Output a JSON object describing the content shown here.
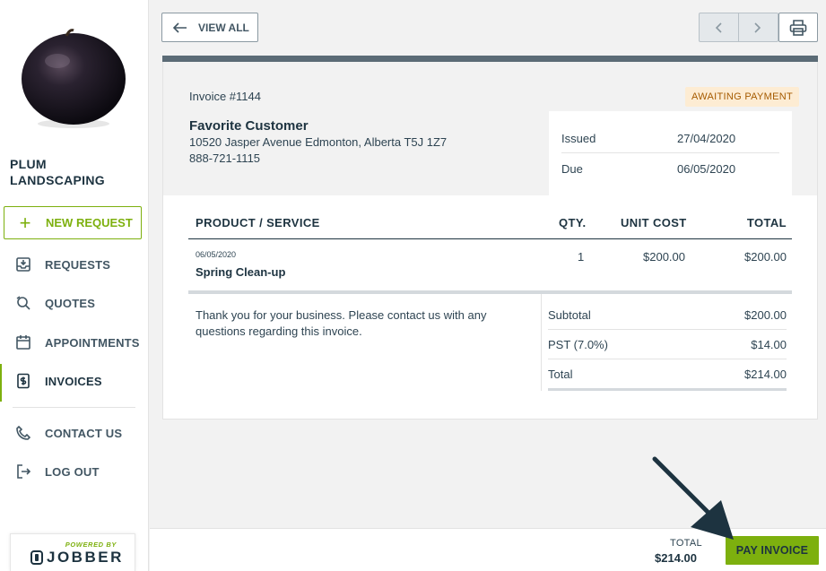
{
  "sidebar": {
    "company_name": "PLUM LANDSCAPING",
    "new_request_label": "NEW REQUEST",
    "items": [
      {
        "label": "REQUESTS",
        "icon": "inbox-icon"
      },
      {
        "label": "QUOTES",
        "icon": "quote-search-icon"
      },
      {
        "label": "APPOINTMENTS",
        "icon": "calendar-icon"
      },
      {
        "label": "INVOICES",
        "icon": "invoice-dollar-icon"
      },
      {
        "label": "CONTACT US",
        "icon": "phone-icon"
      },
      {
        "label": "LOG OUT",
        "icon": "logout-icon"
      }
    ],
    "powered_by": "POWERED BY",
    "brand": "JOBBER"
  },
  "toolbar": {
    "view_all_label": "VIEW ALL"
  },
  "invoice": {
    "number": "Invoice #1144",
    "status": "AWAITING PAYMENT",
    "customer_name": "Favorite Customer",
    "address": "10520 Jasper Avenue Edmonton, Alberta T5J 1Z7",
    "phone": "888-721-1115",
    "issued_label": "Issued",
    "issued_date": "27/04/2020",
    "due_label": "Due",
    "due_date": "06/05/2020",
    "columns": {
      "service": "PRODUCT / SERVICE",
      "qty": "QTY.",
      "unit": "UNIT COST",
      "total": "TOTAL"
    },
    "line_items": [
      {
        "date": "06/05/2020",
        "name": "Spring Clean-up",
        "qty": "1",
        "unit_cost": "$200.00",
        "total": "$200.00"
      }
    ],
    "notes": "Thank you for your business. Please contact us with any questions regarding this invoice.",
    "subtotal_label": "Subtotal",
    "subtotal": "$200.00",
    "tax_label": "PST (7.0%)",
    "tax": "$14.00",
    "total_label": "Total",
    "total": "$214.00"
  },
  "footer": {
    "total_label": "TOTAL",
    "total_value": "$214.00",
    "pay_label": "PAY INVOICE"
  },
  "colors": {
    "accent": "#7db00e",
    "navy": "#1d3340",
    "badge_bg": "#fdecd3",
    "badge_text": "#a55b00"
  }
}
